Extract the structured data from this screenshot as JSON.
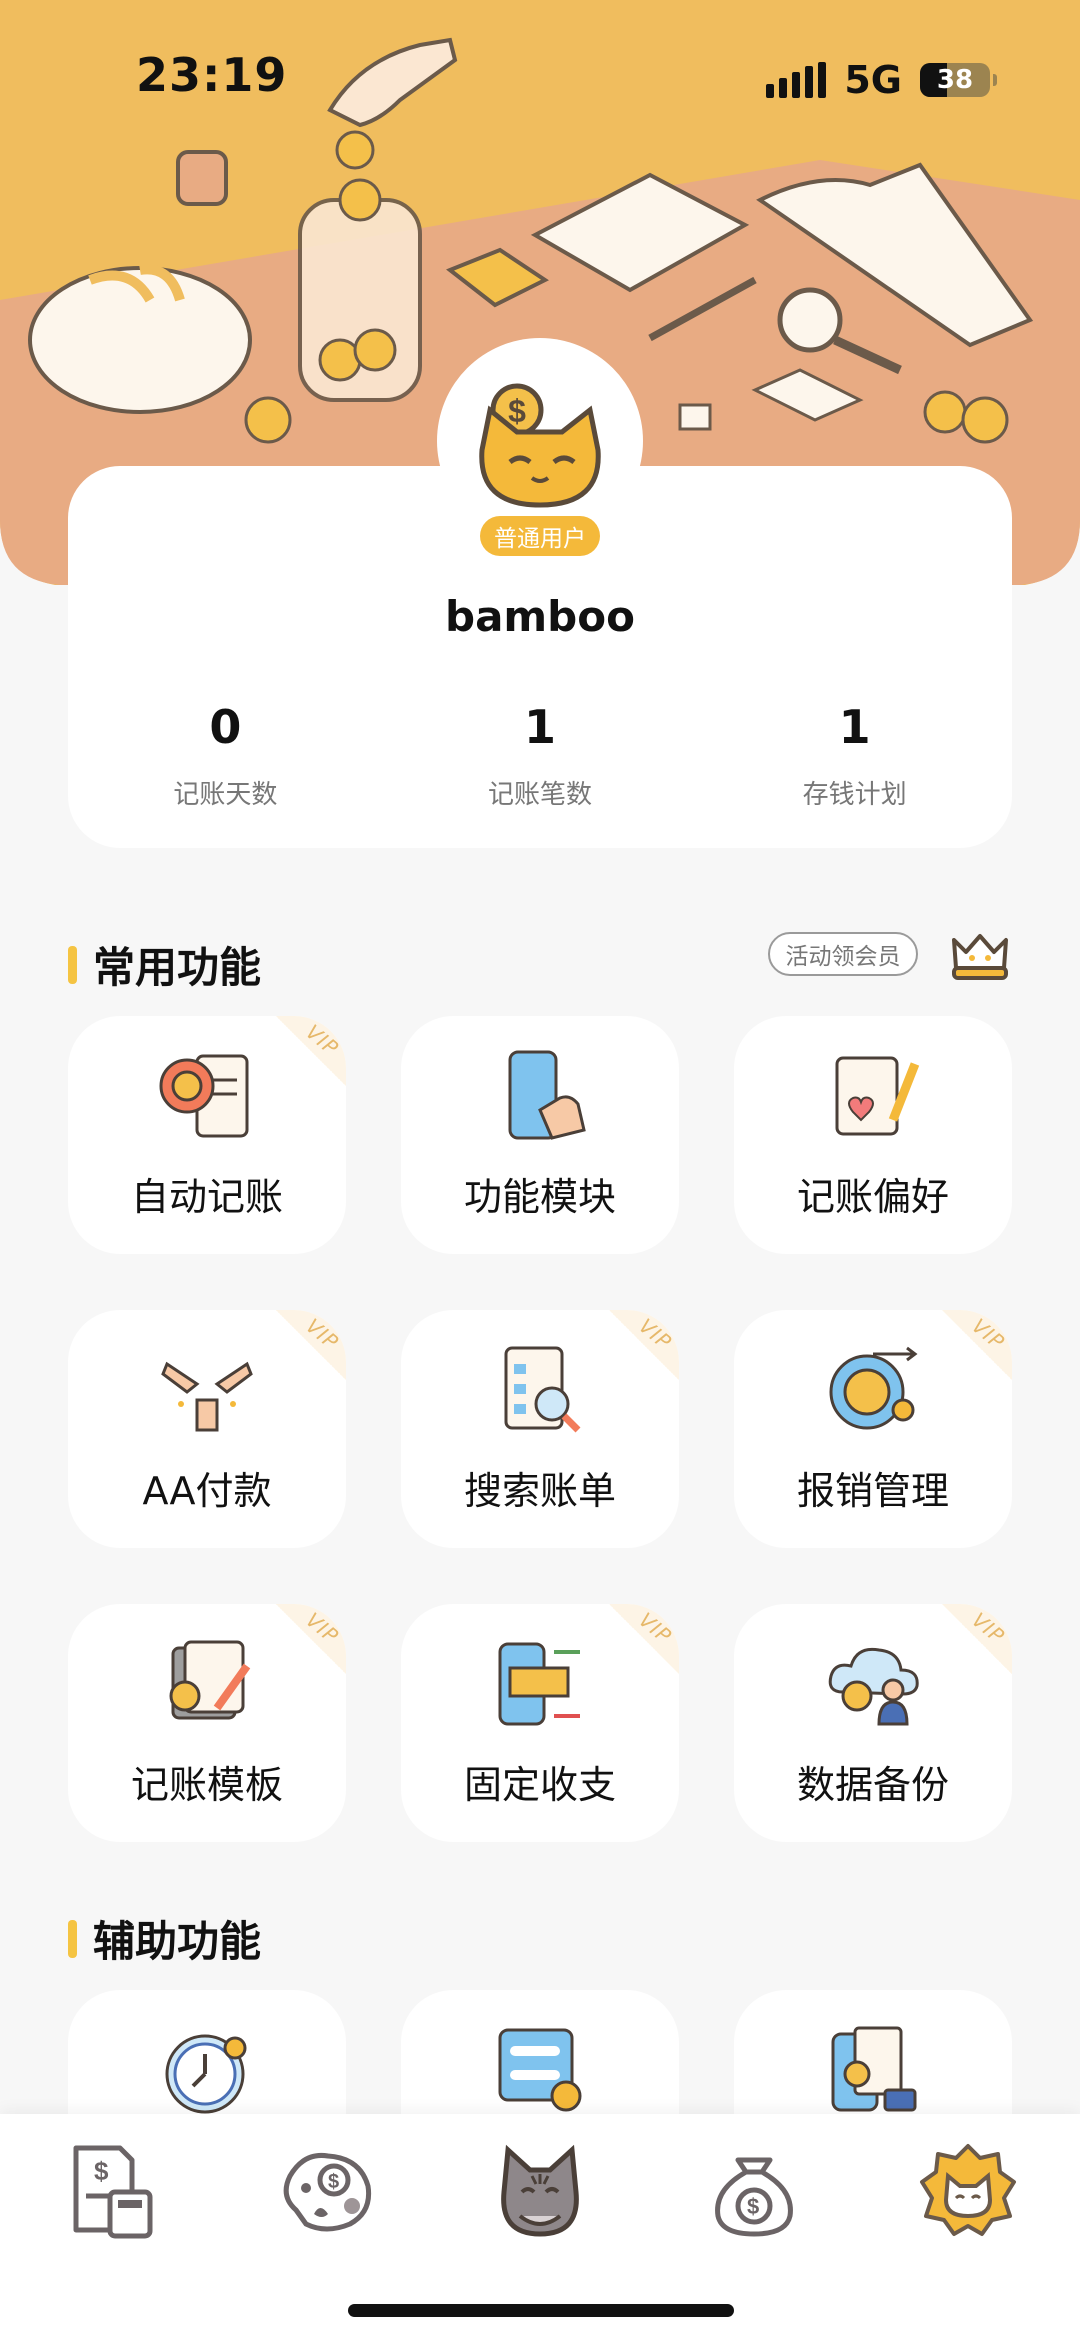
{
  "status": {
    "time": "23:19",
    "network": "5G",
    "battery": "38",
    "battery_level": 0.38
  },
  "profile": {
    "badge": "普通用户",
    "username": "bamboo",
    "stats": [
      {
        "value": "0",
        "label": "记账天数"
      },
      {
        "value": "1",
        "label": "记账笔数"
      },
      {
        "value": "1",
        "label": "存钱计划"
      }
    ]
  },
  "common": {
    "title": "常用功能",
    "promo": "活动领会员",
    "vip_tag": "VIP",
    "items": [
      {
        "label": "自动记账",
        "icon": "auto-record-icon",
        "vip": true
      },
      {
        "label": "功能模块",
        "icon": "phone-tap-icon",
        "vip": false
      },
      {
        "label": "记账偏好",
        "icon": "preference-note-icon",
        "vip": false
      },
      {
        "label": "AA付款",
        "icon": "hands-together-icon",
        "vip": true
      },
      {
        "label": "搜索账单",
        "icon": "search-bill-icon",
        "vip": true
      },
      {
        "label": "报销管理",
        "icon": "reimburse-coin-icon",
        "vip": true
      },
      {
        "label": "记账模板",
        "icon": "template-icon",
        "vip": true
      },
      {
        "label": "固定收支",
        "icon": "fixed-transfer-icon",
        "vip": true
      },
      {
        "label": "数据备份",
        "icon": "cloud-backup-icon",
        "vip": true
      }
    ]
  },
  "assist": {
    "title": "辅助功能",
    "items": [
      {
        "icon": "clock-icon"
      },
      {
        "icon": "settings-panel-icon"
      },
      {
        "icon": "phone-receipt-icon"
      }
    ]
  },
  "nav": [
    {
      "icon": "bill-calculator-icon"
    },
    {
      "icon": "coin-paw-icon"
    },
    {
      "icon": "cat-mascot-icon"
    },
    {
      "icon": "money-bag-icon"
    },
    {
      "icon": "cat-profile-icon"
    }
  ],
  "colors": {
    "header": "#f0bd5e",
    "table": "#e8ab83",
    "accent": "#f4b93a",
    "vip": "#e6b86a"
  }
}
